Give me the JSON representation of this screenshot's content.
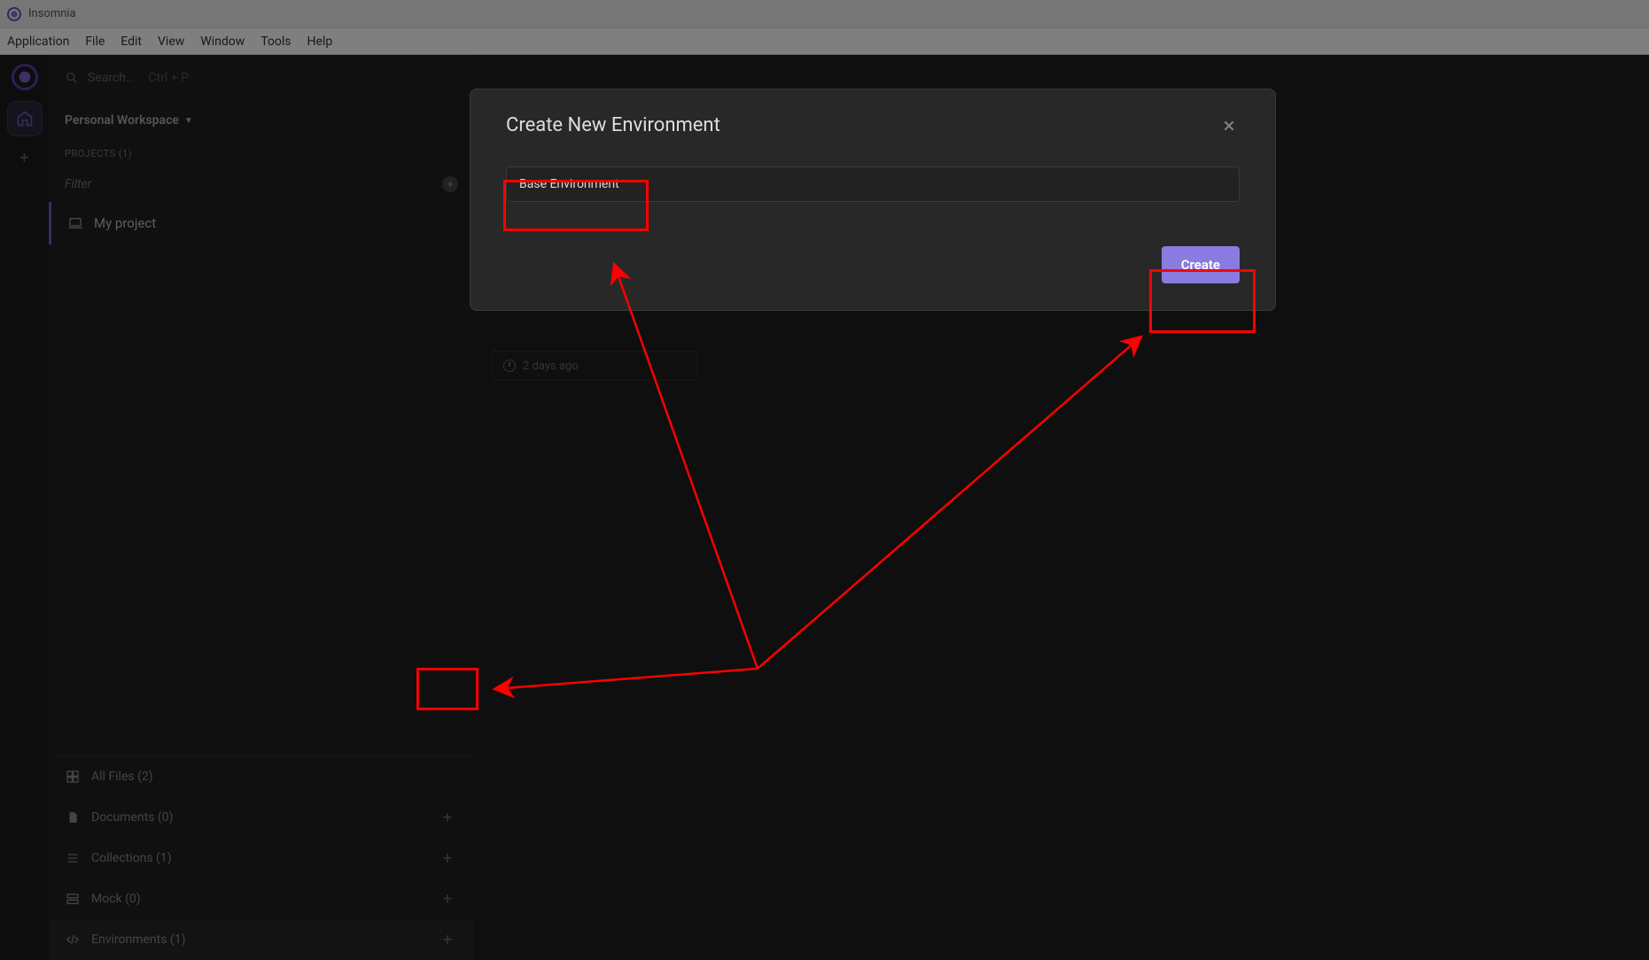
{
  "window": {
    "title": "Insomnia"
  },
  "menu": {
    "items": [
      "Application",
      "File",
      "Edit",
      "View",
      "Window",
      "Tools",
      "Help"
    ]
  },
  "search": {
    "placeholder": "Search..",
    "hint": "Ctrl + P"
  },
  "workspace": {
    "name": "Personal Workspace"
  },
  "projects": {
    "header": "PROJECTS (1)",
    "filter_placeholder": "Filter",
    "items": [
      {
        "label": "My project"
      }
    ]
  },
  "categories": [
    {
      "key": "all",
      "label": "All Files (2)",
      "add": false
    },
    {
      "key": "docs",
      "label": "Documents (0)",
      "add": true
    },
    {
      "key": "coll",
      "label": "Collections (1)",
      "add": true
    },
    {
      "key": "mock",
      "label": "Mock (0)",
      "add": true
    },
    {
      "key": "env",
      "label": "Environments (1)",
      "add": true
    }
  ],
  "card": {
    "time_ago": "2 days ago"
  },
  "modal": {
    "title": "Create New Environment",
    "input_value": "Base Environment",
    "create_label": "Create"
  },
  "colors": {
    "accent": "#8a7be0",
    "highlight": "#ff0000"
  }
}
